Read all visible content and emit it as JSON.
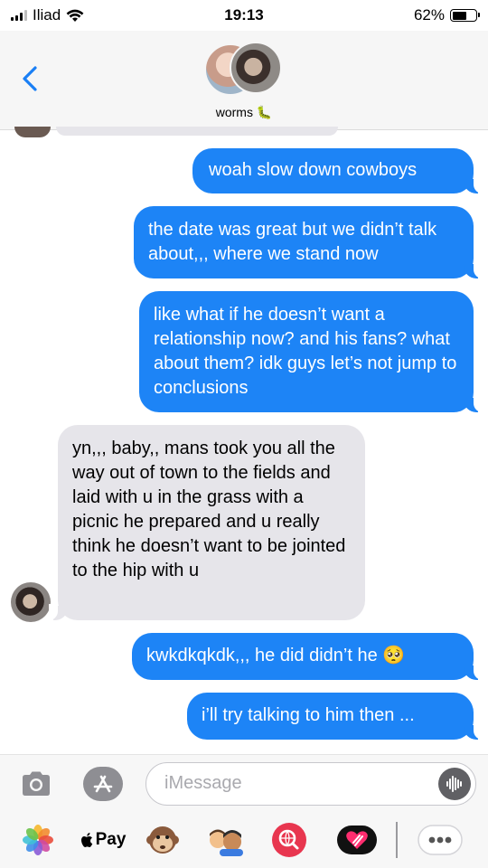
{
  "status_bar": {
    "carrier": "Iliad",
    "time": "19:13",
    "battery": "62%",
    "battery_level": 0.62,
    "icons": [
      "signal-icon",
      "wifi-icon",
      "battery-icon"
    ]
  },
  "header": {
    "back_icon": "chevron-left-icon",
    "contact_name": "worms",
    "contact_emoji": "🐛"
  },
  "messages": [
    {
      "from": "me",
      "text": "woah slow down cowboys"
    },
    {
      "from": "me",
      "text": "the date was great but we didn’t talk about,,, where we stand now"
    },
    {
      "from": "me",
      "text": "like what if he doesn’t want a relationship now? and his fans? what about them? idk guys let’s not jump to conclusions"
    },
    {
      "from": "them",
      "text": "yn,,, baby,, mans took you all the way out of town to the fields and laid with u in the grass with a picnic he prepared and u really think he doesn’t want to be jointed to the hip with u"
    },
    {
      "from": "me",
      "text": "kwkdkqkdk,,, he did didn’t he 🥺"
    },
    {
      "from": "me",
      "text": "i’ll try talking to him then ..."
    }
  ],
  "input": {
    "placeholder": "iMessage",
    "camera_icon": "camera-icon",
    "apps_icon": "app-store-icon",
    "audio_icon": "audio-waveform-icon"
  },
  "app_drawer": {
    "pay_label": "Pay",
    "items": [
      "photos-icon",
      "apple-pay-icon",
      "animoji-monkey-icon",
      "memoji-icon",
      "web-search-icon",
      "digital-touch-heart-icon",
      "more-icon"
    ]
  },
  "colors": {
    "sent_bubble": "#1d84f6",
    "received_bubble": "#e6e5ea",
    "accent": "#1a7ff5"
  }
}
